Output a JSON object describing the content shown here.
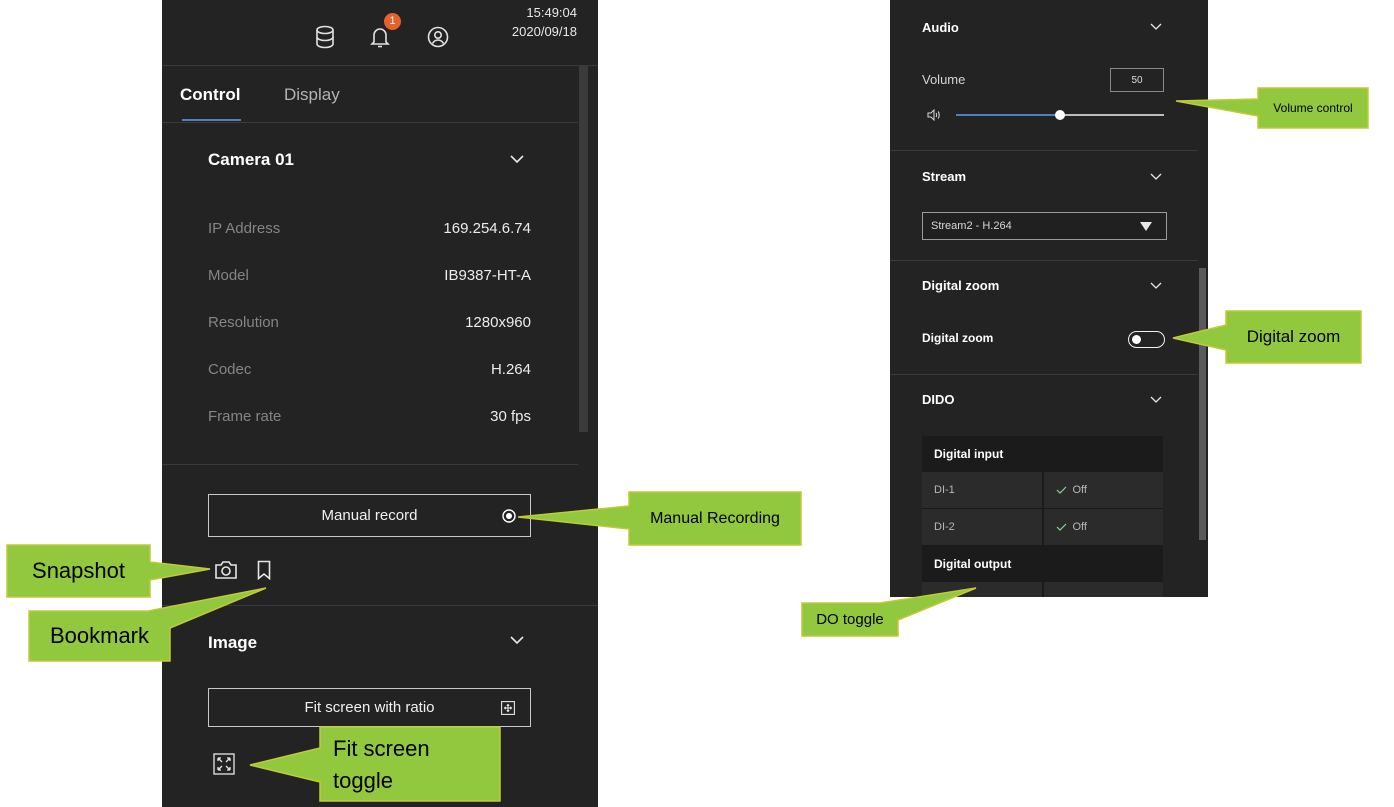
{
  "colors": {
    "panel_bg": "#232323",
    "accent": "#4f7fc0",
    "badge": "#e5622a",
    "callout_fill": "#92c83e",
    "callout_border": "#c2c93a",
    "callout_text": "#000000"
  },
  "left_panel": {
    "header": {
      "icons": [
        "database-icon",
        "bell-icon",
        "user-icon"
      ],
      "notification_count": "1",
      "time": "15:49:04",
      "date": "2020/09/18"
    },
    "tabs": [
      {
        "label": "Control",
        "active": true
      },
      {
        "label": "Display",
        "active": false
      }
    ],
    "camera": {
      "title": "Camera 01",
      "rows": [
        {
          "label": "IP Address",
          "value": "169.254.6.74"
        },
        {
          "label": "Model",
          "value": "IB9387-HT-A"
        },
        {
          "label": "Resolution",
          "value": "1280x960"
        },
        {
          "label": "Codec",
          "value": "H.264"
        },
        {
          "label": "Frame rate",
          "value": "30 fps"
        }
      ]
    },
    "manual_record_label": "Manual record",
    "quick_actions": [
      "camera-icon",
      "bookmark-icon"
    ],
    "image_section": {
      "title": "Image",
      "fit_button_label": "Fit screen with ratio",
      "fit_toggle_icon": "fullscreen-icon"
    }
  },
  "right_panel": {
    "audio": {
      "title": "Audio",
      "volume_label": "Volume",
      "volume_value": "50"
    },
    "stream": {
      "title": "Stream",
      "selected": "Stream2 - H.264"
    },
    "digital_zoom": {
      "title": "Digital zoom",
      "toggle_label": "Digital zoom",
      "enabled": false
    },
    "dido": {
      "title": "DIDO",
      "digital_input_header": "Digital input",
      "inputs": [
        {
          "name": "DI-1",
          "state": "Off"
        },
        {
          "name": "DI-2",
          "state": "Off"
        }
      ],
      "digital_output_header": "Digital output"
    }
  },
  "callouts": {
    "snapshot": "Snapshot",
    "bookmark": "Bookmark",
    "manual_recording": "Manual Recording",
    "fit_screen_toggle": "Fit screen toggle",
    "volume_control": "Volume control",
    "digital_zoom": "Digital zoom",
    "do_toggle": "DO toggle"
  }
}
